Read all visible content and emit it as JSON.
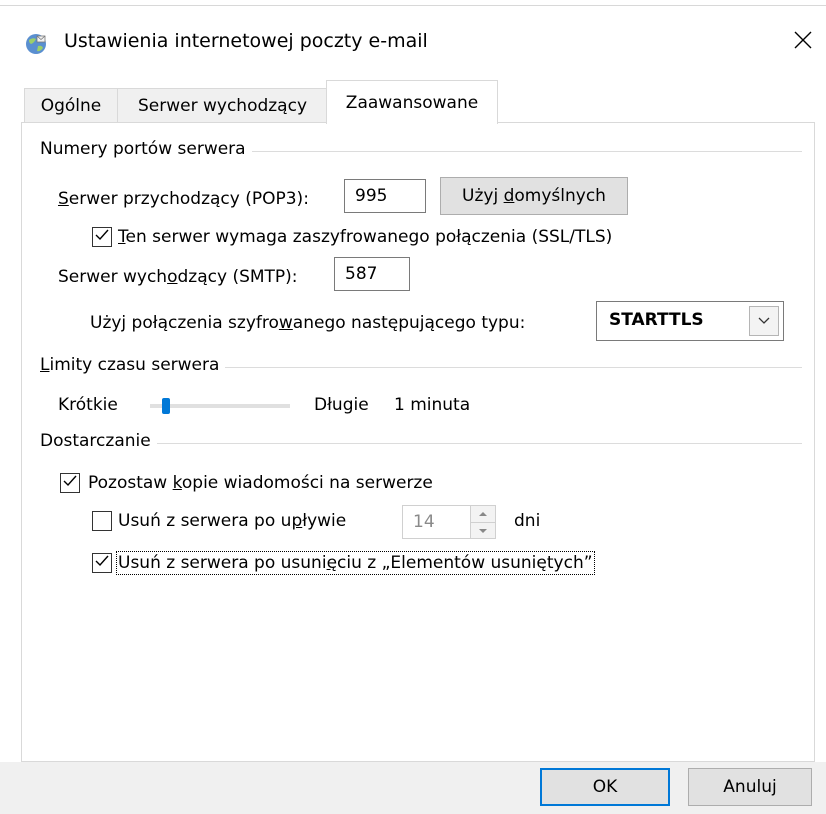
{
  "window": {
    "title": "Ustawienia internetowej poczty e-mail",
    "icon": "mail-globe-icon",
    "close": "×"
  },
  "tabs": [
    {
      "label": "Ogólne",
      "active": false
    },
    {
      "label": "Serwer wychodzący",
      "active": false
    },
    {
      "label": "Zaawansowane",
      "active": true
    }
  ],
  "ports": {
    "group_title": "Numery portów serwera",
    "incoming_label_u": "S",
    "incoming_label_rest": "erwer przychodzący (POP3):",
    "incoming_value": "995",
    "use_defaults_pre": "Użyj ",
    "use_defaults_u": "d",
    "use_defaults_post": "omyślnych",
    "ssl_checked": true,
    "ssl_label_u": "T",
    "ssl_label_rest": "en serwer wymaga zaszyfrowanego połączenia (SSL/TLS)",
    "outgoing_label_pre": "Serwer wych",
    "outgoing_label_u": "o",
    "outgoing_label_post": "dzący (SMTP):",
    "outgoing_value": "587",
    "encryption_label_pre": "Użyj połączenia szyfro",
    "encryption_label_u": "w",
    "encryption_label_post": "anego następującego typu:",
    "encryption_value": "STARTTLS"
  },
  "timeouts": {
    "group_title_u": "L",
    "group_title_rest": "imity czasu serwera",
    "short_label": "Krótkie",
    "long_label": "Długie",
    "value_label": "1 minuta",
    "slider_level": 0.1
  },
  "delivery": {
    "group_title": "Dostarczanie",
    "leave_copy_checked": true,
    "leave_copy_pre": "Pozostaw ",
    "leave_copy_u": "k",
    "leave_copy_post": "opie wiadomości na serwerze",
    "remove_after_checked": false,
    "remove_after_pre": "Usuń z serwera po u",
    "remove_after_u": "p",
    "remove_after_post": "ływie",
    "days_value": "14",
    "days_unit": "dni",
    "remove_deleted_checked": true,
    "remove_deleted_pre": "Usuń z serwera po usuni",
    "remove_deleted_u": "ę",
    "remove_deleted_post": "ciu z „Elementów usuniętych”"
  },
  "buttons": {
    "ok": "OK",
    "cancel": "Anuluj"
  },
  "colors": {
    "accent": "#0078d7"
  }
}
